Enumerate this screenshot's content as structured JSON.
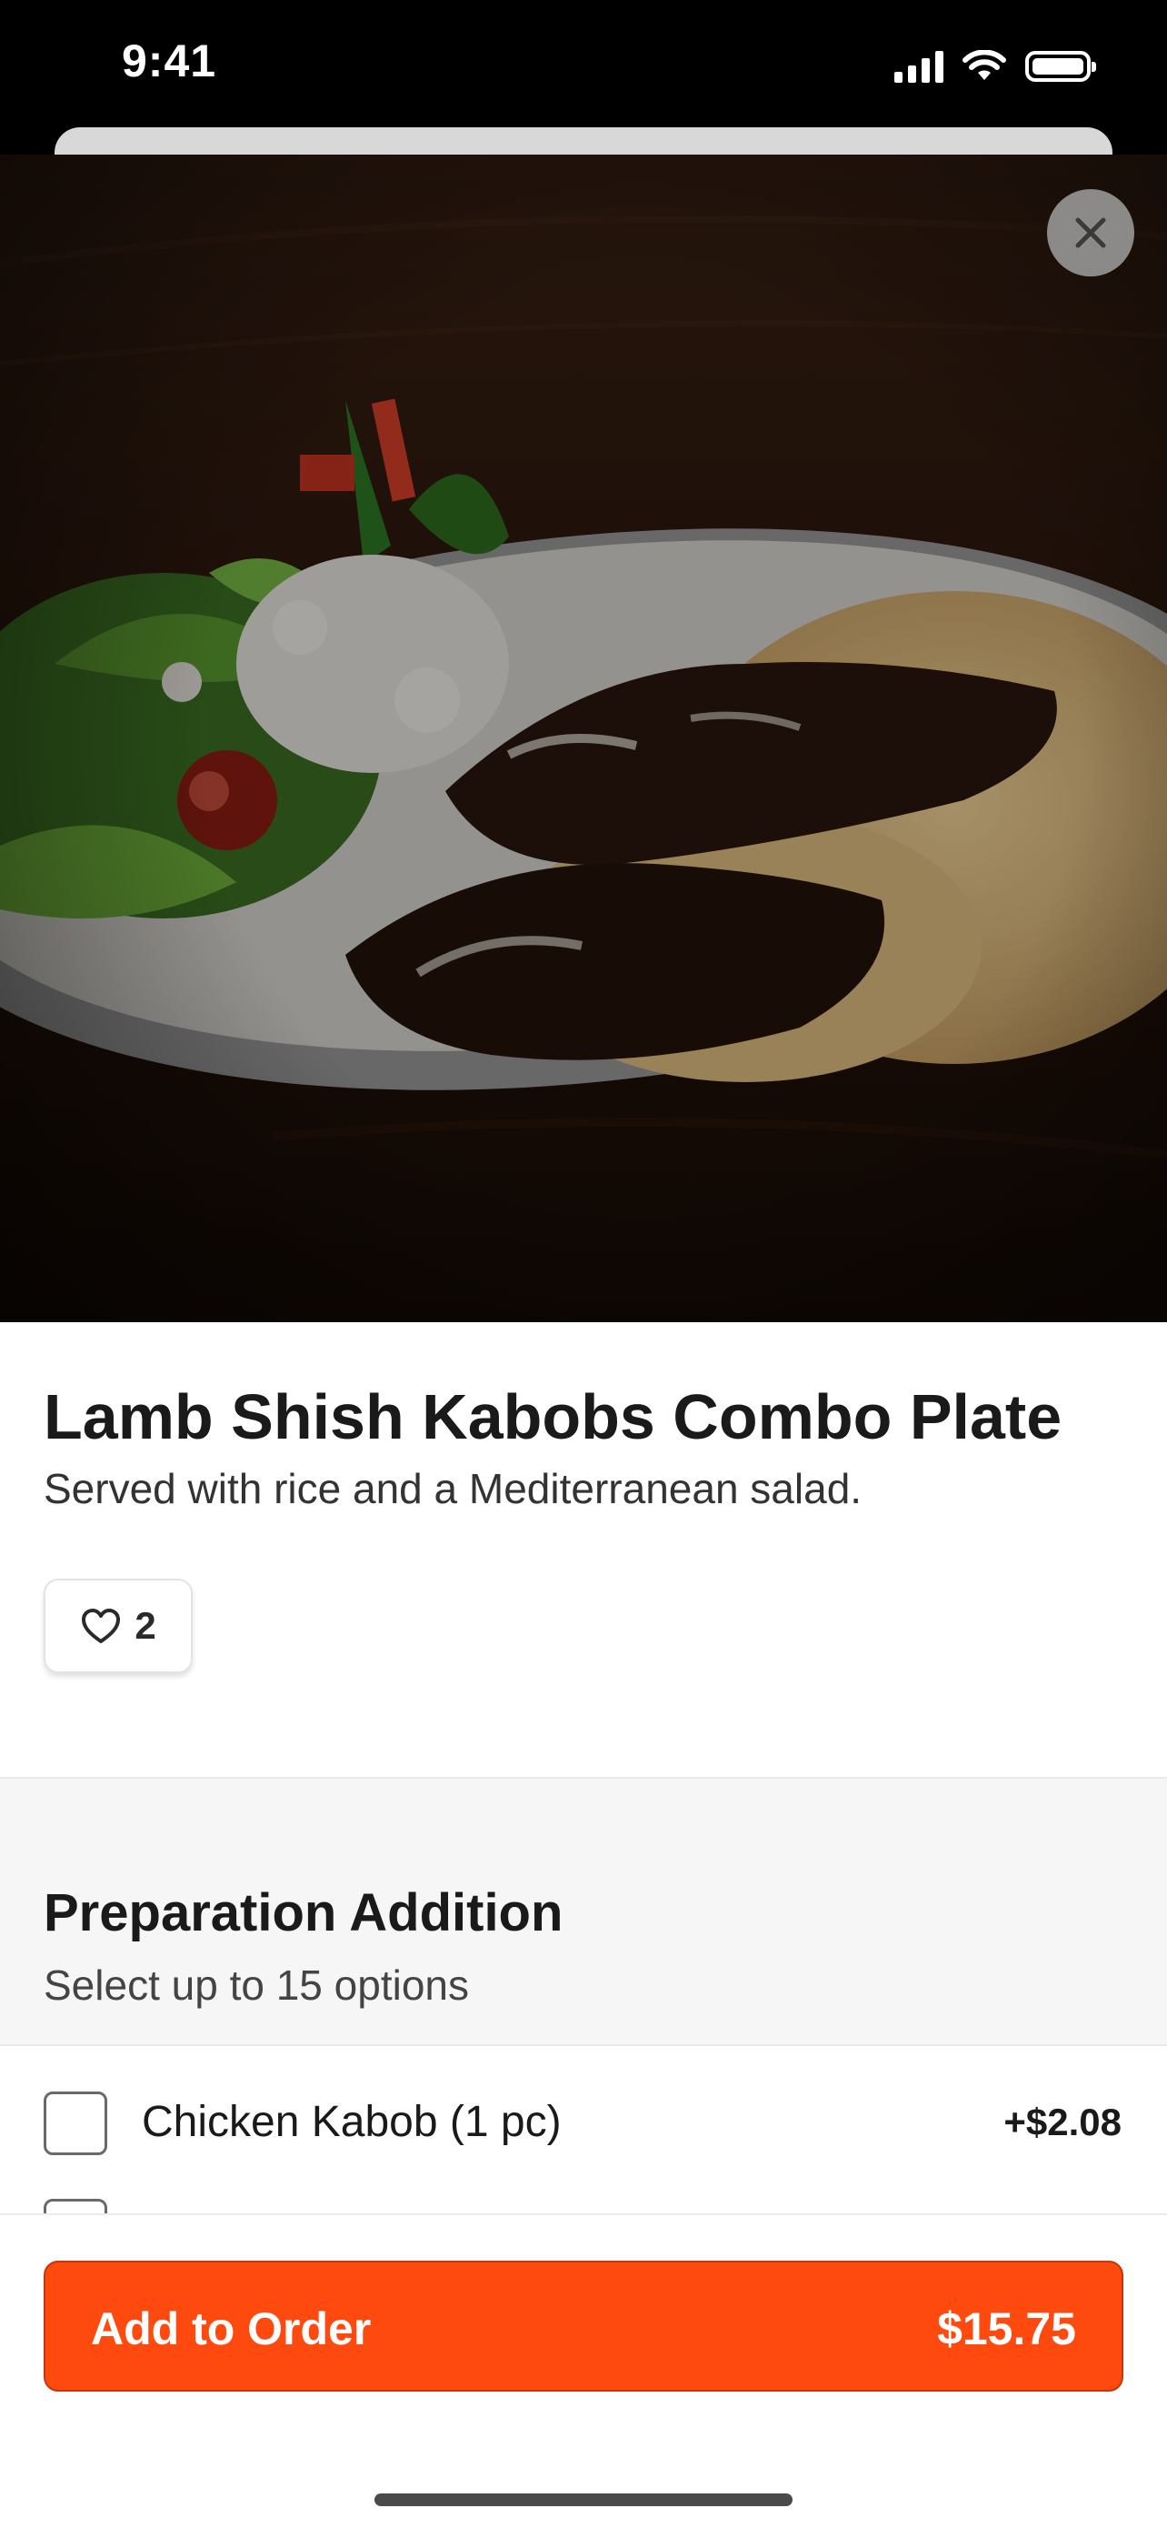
{
  "status_bar": {
    "time": "9:41"
  },
  "hero": {
    "image": "Lamb shish kabobs with rice, feta and Mediterranean salad on a plate"
  },
  "close_button": {
    "icon": "close-icon"
  },
  "item": {
    "title": "Lamb Shish Kabobs Combo Plate",
    "description": "Served with rice and a Mediterranean salad.",
    "likes": "2"
  },
  "section": {
    "title": "Preparation Addition",
    "subtitle": "Select up to 15 options"
  },
  "options": [
    {
      "label": "Chicken Kabob (1 pc)",
      "price": "+$2.08"
    }
  ],
  "cta": {
    "label": "Add to Order",
    "price": "$15.75"
  },
  "colors": {
    "accent": "#ff4a0f"
  }
}
